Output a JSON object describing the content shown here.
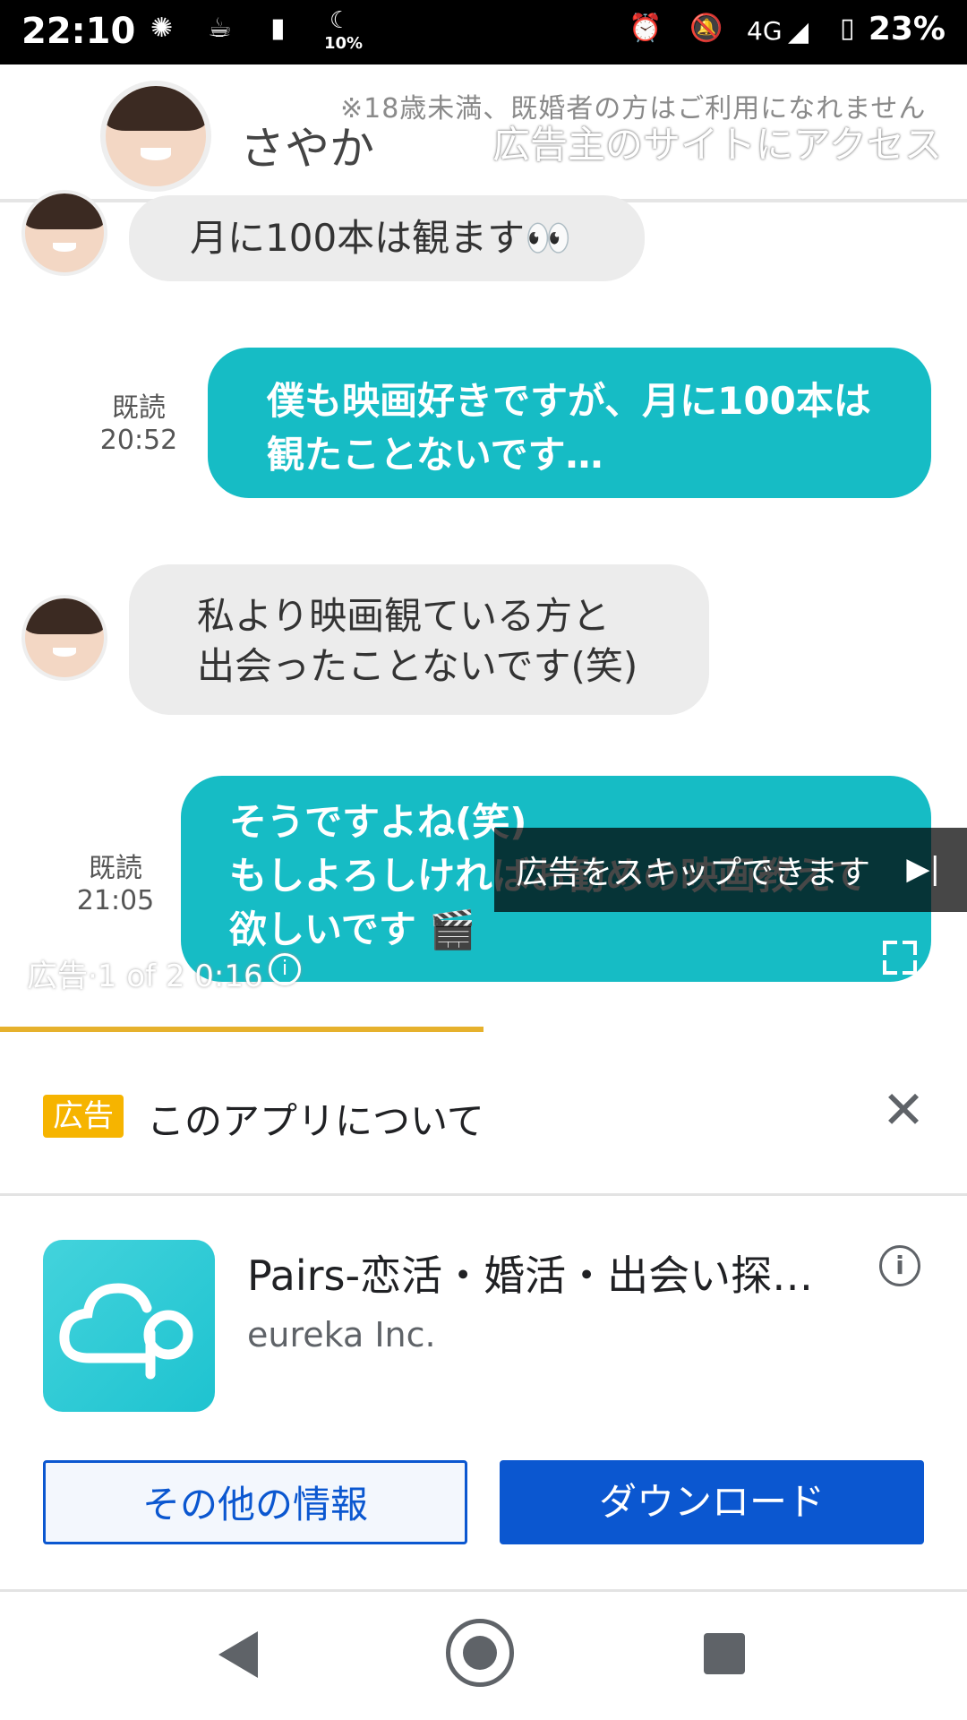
{
  "status_bar": {
    "time": "22:10",
    "moon_percent": "10%",
    "network": "4G",
    "battery": "23%",
    "icons": [
      "brightness-icon",
      "drink-icon",
      "battery-saver-icon",
      "moon-icon",
      "alarm-icon",
      "bell-off-icon",
      "signal-icon",
      "battery-icon"
    ]
  },
  "video_ad": {
    "chat_name": "さやか",
    "notice": "※18歳未満、既婚者の方はご利用になれません",
    "visit_advertiser": "広告主のサイトにアクセス",
    "messages": [
      {
        "from": "other",
        "text": "月に100本は観ます👀"
      },
      {
        "from": "me",
        "read": "既読",
        "time": "20:52",
        "line1": "僕も映画好きですが、月に100本は",
        "line2": "観たことないです…"
      },
      {
        "from": "other",
        "line1": "私より映画観ている方と",
        "line2": "出会ったことないです(笑)"
      },
      {
        "from": "me",
        "read": "既読",
        "time": "21:05",
        "line1": "そうですよね(笑)",
        "line2": "もしよろしければお勧めの映画教えて",
        "line3": "欲しいです 🎬"
      }
    ],
    "skip_label": "広告をスキップできます",
    "ad_counter": "広告·1 of 2 0:16",
    "progress": 0.5
  },
  "app_panel": {
    "badge": "広告",
    "title": "このアプリについて",
    "app_name": "Pairs-恋活・婚活・出会い探…",
    "developer": "eureka Inc.",
    "more_info_button": "その他の情報",
    "download_button": "ダウンロード",
    "accent_color": "#0b57d0",
    "badge_color": "#f6b400"
  }
}
